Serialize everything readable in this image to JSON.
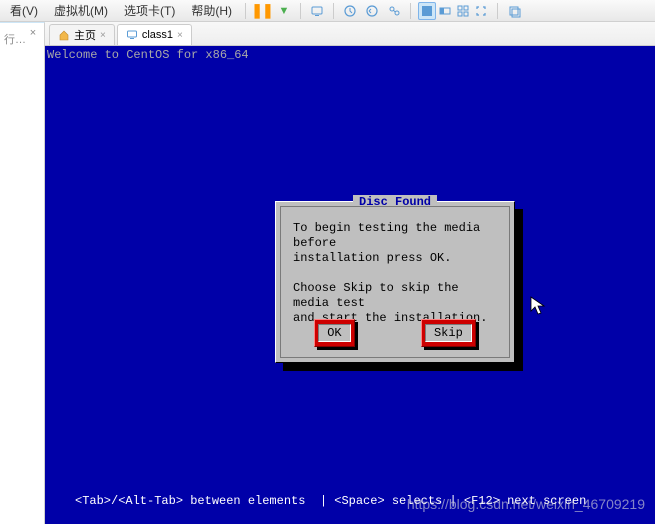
{
  "menu": {
    "view": "看(V)",
    "vm": "虚拟机(M)",
    "tabs_opt": "选项卡(T)",
    "help": "帮助(H)"
  },
  "sidebar": {
    "label": "行…",
    "close": "×"
  },
  "tabs": {
    "home": "主页",
    "vm_name": "class1",
    "close": "×"
  },
  "vm": {
    "top_line": "Welcome to CentOS for x86_64",
    "bottom_line": "<Tab>/<Alt-Tab> between elements  | <Space> selects | <F12> next screen"
  },
  "dialog": {
    "title": "Disc Found",
    "body": "To begin testing the media before\ninstallation press OK.\n\nChoose Skip to skip the media test\nand start the installation.",
    "ok": "OK",
    "skip": "Skip"
  },
  "watermark": "https://blog.csdn.net/weixin_46709219"
}
